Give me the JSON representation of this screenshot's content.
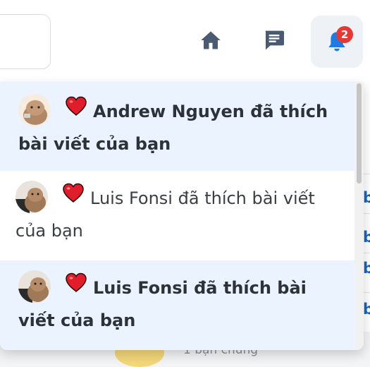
{
  "navbar": {
    "home_icon": "home-icon",
    "chat_icon": "chat-icon",
    "bell_icon": "bell-icon",
    "notification_count": "2"
  },
  "notifications": [
    {
      "name": "Andrew Nguyen",
      "action": "đã thích bài viết của bạn",
      "reaction_icon": "heart-icon",
      "unread": true
    },
    {
      "name": "Luis Fonsi",
      "action": "đã thích bài viết của bạn",
      "reaction_icon": "heart-icon",
      "unread": false
    },
    {
      "name": "Luis Fonsi",
      "action": "đã thích bài viết của bạn",
      "reaction_icon": "heart-icon",
      "unread": true
    }
  ],
  "background_page": {
    "partial_letters": [
      "b",
      "b",
      "b",
      "b"
    ],
    "partial_caption": "1 bạn chung"
  },
  "colors": {
    "accent": "#1565c0",
    "badge": "#e53935",
    "unread_bg": "#eaf3ff",
    "heart": "#e21d2b"
  }
}
